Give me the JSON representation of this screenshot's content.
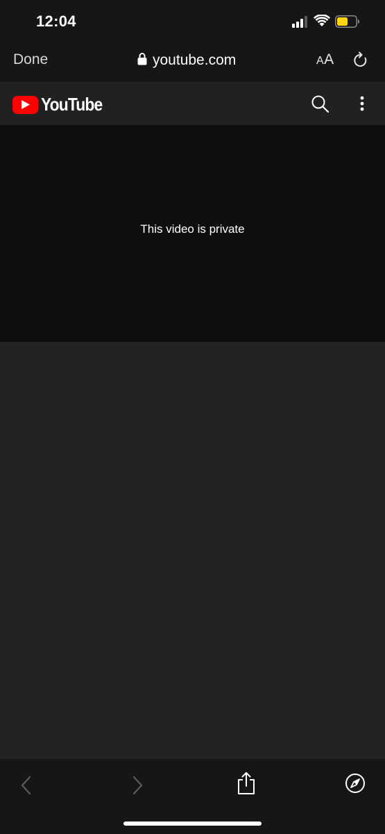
{
  "status_bar": {
    "time": "12:04",
    "signal_icon": "cellular-signal-icon",
    "wifi_icon": "wifi-icon",
    "battery_icon": "battery-icon",
    "battery_color": "#ffd60a"
  },
  "browser": {
    "done_label": "Done",
    "lock_icon": "lock-icon",
    "url": "youtube.com",
    "text_size_small": "A",
    "text_size_large": "A",
    "reload_icon": "reload-icon"
  },
  "youtube_header": {
    "logo_text": "YouTube",
    "brand_color": "#ff0000",
    "search_icon": "search-icon",
    "more_icon": "more-vertical-icon"
  },
  "player": {
    "message": "This video is private"
  },
  "toolbar": {
    "back_icon": "back-icon",
    "forward_icon": "forward-icon",
    "share_icon": "share-icon",
    "safari_icon": "compass-icon"
  }
}
